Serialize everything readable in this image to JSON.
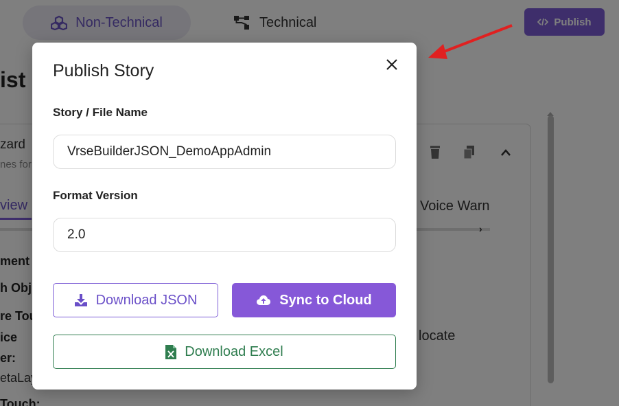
{
  "header": {
    "tab_nontechnical": "Non-Technical",
    "tab_technical": "Technical",
    "publish_label": "Publish"
  },
  "background": {
    "page_title_fragment": "ist",
    "panel_title_fragment": "zard",
    "panel_subtitle_fragment": "nes for",
    "panel_tab_fragment": "view",
    "panel_tab_right": "Voice Warn",
    "field_labels": [
      "ment N",
      "h Obj",
      "re Tou",
      "ice",
      "er:",
      "",
      "Touch:"
    ],
    "field_value_fragment": "etaLay",
    "right_value_fragment": "locate"
  },
  "modal": {
    "title": "Publish Story",
    "name_label": "Story / File Name",
    "name_value": "VrseBuilderJSON_DemoAppAdmin",
    "version_label": "Format Version",
    "version_value": "2.0",
    "download_json_label": "Download JSON",
    "sync_cloud_label": "Sync to Cloud",
    "download_excel_label": "Download Excel"
  },
  "colors": {
    "accent": "#7c5cd6",
    "excel_green": "#2f7d4f",
    "annotation_arrow": "#e02020"
  }
}
